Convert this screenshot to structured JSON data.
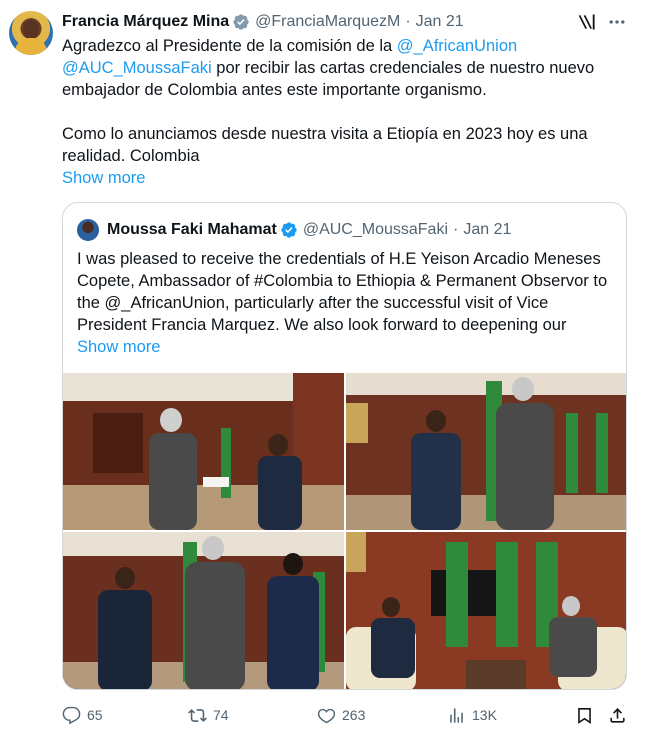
{
  "author": {
    "name": "Francia Márquez Mina",
    "handle": "@FranciaMarquezM",
    "separator": "·",
    "date": "Jan 21"
  },
  "tweet": {
    "line1_prefix": "Agradezco al Presidente de la  comisión de la ",
    "mention_au": "@_AfricanUnion",
    "mention_faki": "@AUC_MoussaFaki",
    "line2_suffix": " por recibir las cartas credenciales de nuestro nuevo embajador de Colombia antes este importante organismo.",
    "paragraph2": "Como lo anunciamos desde nuestra visita a Etiopía en 2023 hoy es una realidad. Colombia",
    "show_more": "Show more"
  },
  "quoted": {
    "name": "Moussa Faki Mahamat",
    "handle": "@AUC_MoussaFaki",
    "separator": "·",
    "date": "Jan 21",
    "text": "I was pleased to receive the credentials of H.E Yeison Arcadio Meneses Copete, Ambassador of #Colombia to Ethiopia & Permanent Observor to the @_AfricanUnion, particularly after the successful visit of Vice President Francia Marquez. We also look forward to deepening our",
    "show_more": "Show more"
  },
  "actions": {
    "replies": "65",
    "reposts": "74",
    "likes": "263",
    "views": "13K"
  },
  "icons": {
    "verified": "verified-badge-icon",
    "grok": "grok-icon",
    "more": "more-icon",
    "reply": "reply-icon",
    "repost": "repost-icon",
    "like": "heart-icon",
    "views": "views-icon",
    "bookmark": "bookmark-icon",
    "share": "share-icon"
  },
  "colors": {
    "text": "#0f1419",
    "secondary": "#536471",
    "link": "#1d9bf0",
    "border": "#cfd9de"
  }
}
